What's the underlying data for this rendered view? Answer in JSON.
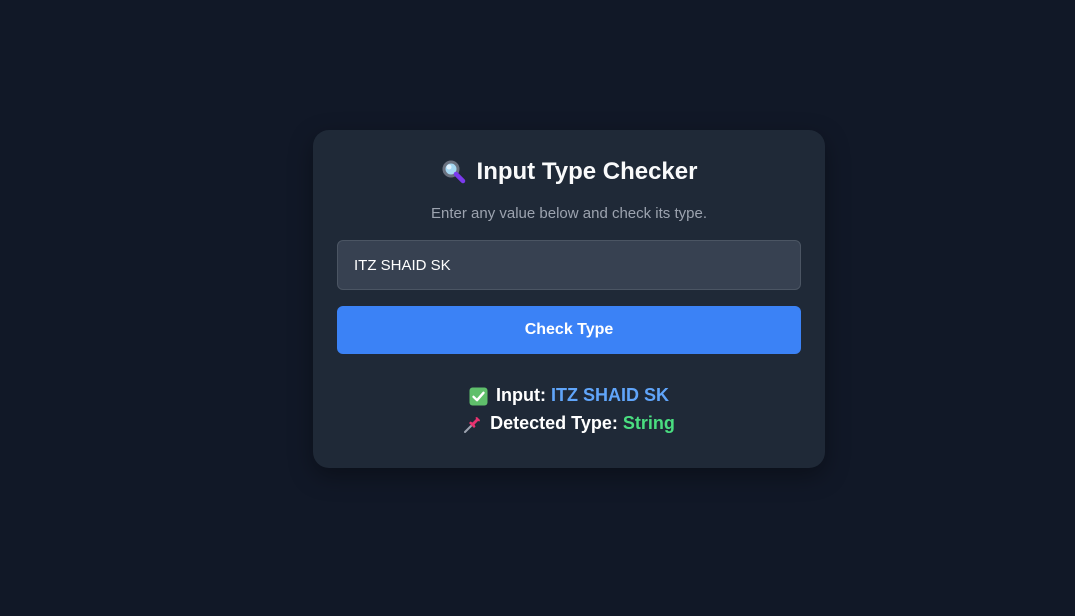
{
  "app": {
    "title": "Input Type Checker",
    "title_icon": "magnifying-glass-icon",
    "subtitle": "Enter any value below and check its type."
  },
  "form": {
    "input_value": "ITZ SHAID SK",
    "button_label": "Check Type"
  },
  "result": {
    "input_icon": "check-mark-icon",
    "input_label": "Input:",
    "input_value": "ITZ SHAID SK",
    "type_icon": "pushpin-icon",
    "type_label": "Detected Type:",
    "type_value": "String"
  },
  "colors": {
    "page_background": "#111827",
    "card_background": "#1f2937",
    "input_background": "#374151",
    "button": "#3b82f6",
    "input_value_color": "#60a5fa",
    "type_value_color": "#4ade80"
  }
}
